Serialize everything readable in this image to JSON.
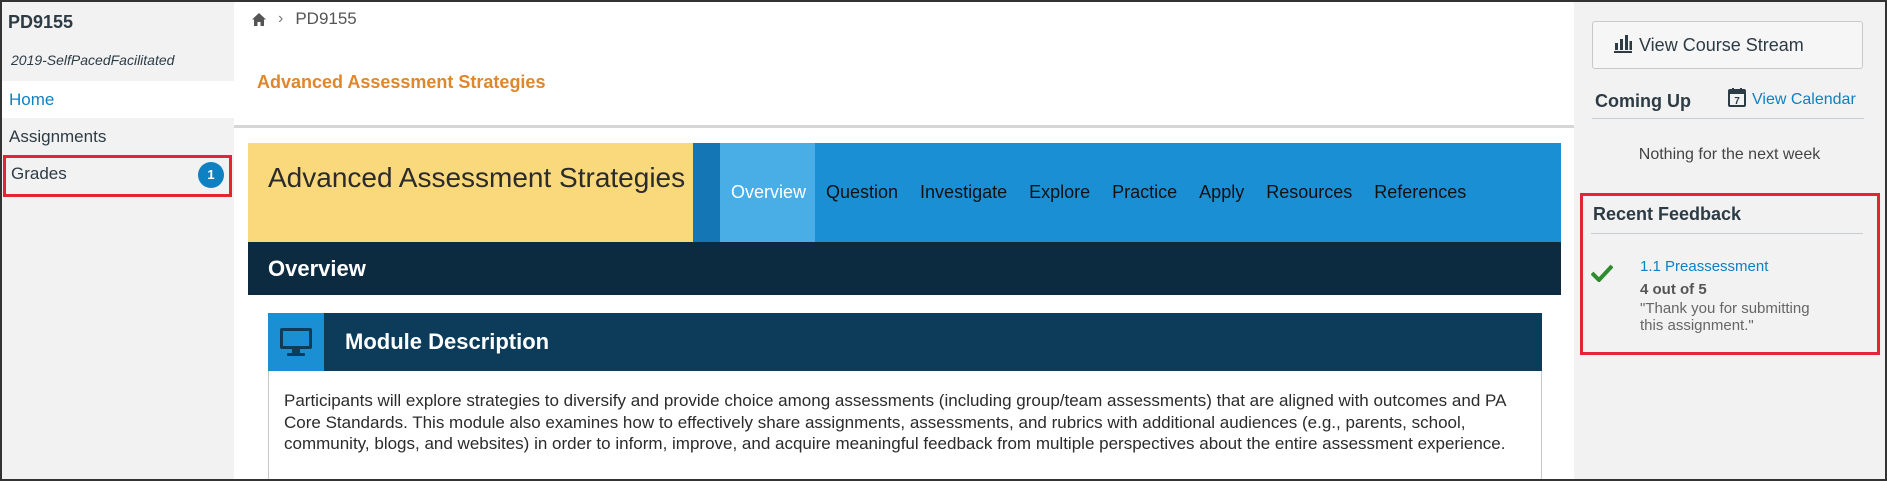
{
  "course": {
    "code": "PD9155",
    "term": "2019-SelfPacedFacilitated"
  },
  "nav": {
    "home": "Home",
    "assignments": "Assignments",
    "grades": "Grades",
    "grades_badge": "1"
  },
  "breadcrumb": {
    "home_icon": "home-icon",
    "current": "PD9155"
  },
  "page": {
    "header": "Advanced Assessment Strategies"
  },
  "module": {
    "title": "Advanced Assessment Strategies",
    "tabs": [
      "Overview",
      "Question",
      "Investigate",
      "Explore",
      "Practice",
      "Apply",
      "Resources",
      "References"
    ],
    "active_tab": "Overview",
    "section": "Overview",
    "description_title": "Module Description",
    "description_icon": "monitor-icon",
    "description": "Participants will explore strategies to diversify and provide choice among assessments (including group/team assessments) that are aligned with outcomes and PA Core Standards. This module also examines how to effectively share assignments, assessments, and rubrics with additional audiences (e.g., parents, school, community, blogs, and websites) in order to inform, improve, and acquire meaningful feedback from multiple perspectives about the entire assessment experience."
  },
  "sidebar": {
    "stream_button": "View Course Stream",
    "stream_icon": "bar-chart-icon",
    "coming_up": "Coming Up",
    "calendar_link": "View Calendar",
    "calendar_icon": "calendar-icon",
    "calendar_day": "7",
    "nothing_text": "Nothing for the next week",
    "feedback_title": "Recent Feedback",
    "feedback": {
      "assignment": "1.1 Preassessment",
      "score": "4 out of 5",
      "comment": "\"Thank you for submitting this assignment.\""
    }
  },
  "colors": {
    "accent_blue": "#1b8fd4",
    "active_tab": "#49ade6",
    "dark_navy": "#0d2b40",
    "banner_yellow": "#f9d97b",
    "header_orange": "#e0862b",
    "highlight_red": "#e32434",
    "check_green": "#2e8b2e"
  }
}
